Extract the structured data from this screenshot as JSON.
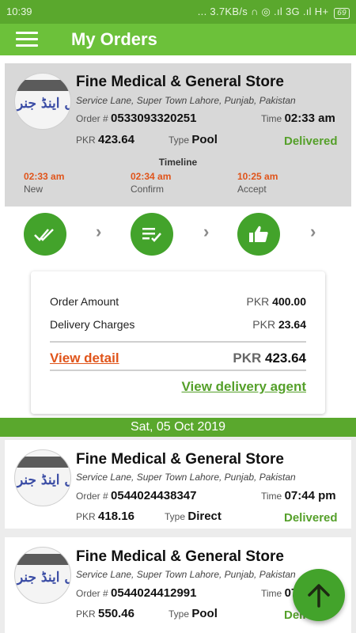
{
  "status_bar": {
    "time": "10:39",
    "indicators": "... 3.7KB/s ∩ ◎ .ıl 3G .ıl H+",
    "battery": "69"
  },
  "app_bar": {
    "title": "My Orders",
    "menu_icon": "hamburger-menu-icon"
  },
  "expanded_order": {
    "store_name": "Fine Medical & General Store",
    "address": "Service Lane, Super Town Lahore, Punjab, Pakistan",
    "order_label": "Order #",
    "order_number": "0533093320251",
    "time_label": "Time",
    "time": "02:33 am",
    "currency": "PKR",
    "amount": "423.64",
    "type_label": "Type",
    "type": "Pool",
    "status": "Delivered",
    "timeline_title": "Timeline",
    "timeline": [
      {
        "time": "02:33 am",
        "label": "New",
        "icon": "double-check-icon"
      },
      {
        "time": "02:34 am",
        "label": "Confirm",
        "icon": "list-check-icon"
      },
      {
        "time": "10:25 am",
        "label": "Accept",
        "icon": "thumbs-up-icon"
      }
    ],
    "summary": {
      "order_amount_label": "Order Amount",
      "order_amount_currency": "PKR",
      "order_amount": "400.00",
      "delivery_label": "Delivery Charges",
      "delivery_currency": "PKR",
      "delivery": "23.64",
      "view_detail": "View detail",
      "total_currency": "PKR",
      "total": "423.64",
      "view_agent": "View delivery agent"
    }
  },
  "date_header": "Sat, 05 Oct 2019",
  "orders": [
    {
      "store_name": "Fine Medical & General Store",
      "address": "Service Lane, Super Town Lahore, Punjab, Pakistan",
      "order_label": "Order #",
      "order_number": "0544024438347",
      "time_label": "Time",
      "time": "07:44 pm",
      "currency": "PKR",
      "amount": "418.16",
      "type_label": "Type",
      "type": "Direct",
      "status": "Delivered"
    },
    {
      "store_name": "Fine Medical & General Store",
      "address": "Service Lane, Super Town Lahore, Punjab, Pakistan",
      "order_label": "Order #",
      "order_number": "0544024412991",
      "time_label": "Time",
      "time": "07",
      "currency": "PKR",
      "amount": "550.46",
      "type_label": "Type",
      "type": "Pool",
      "status": "Deli"
    }
  ],
  "logo_text": "ل اینڈ جنر",
  "fab": {
    "icon": "arrow-up-icon"
  },
  "colors": {
    "primary": "#6cc13a",
    "dark": "#5aa82d",
    "accent": "#e0541a",
    "icon_green": "#43a32b"
  }
}
